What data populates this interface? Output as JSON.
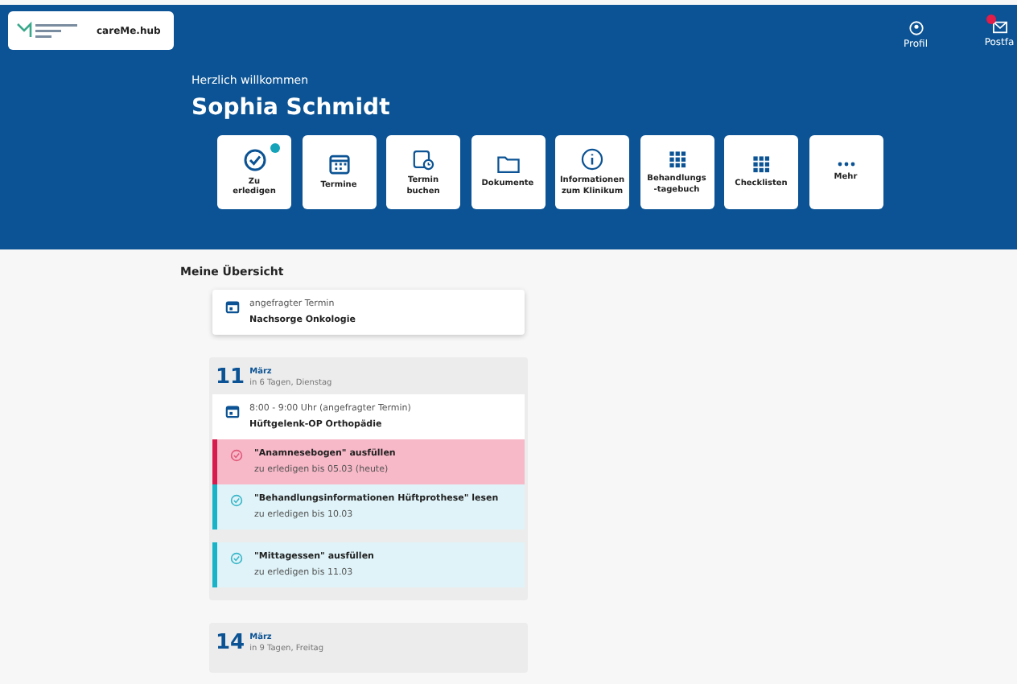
{
  "header": {
    "logo_text": "careMe.hub",
    "nav": [
      {
        "kind": "profile",
        "label": "Profil",
        "badge": false
      },
      {
        "kind": "mail",
        "label": "Postfa",
        "badge": true
      }
    ],
    "greeting": "Herzlich willkommen",
    "name": "Sophia Schmidt"
  },
  "actions": [
    {
      "kind": "check",
      "label": "Zu erledigen",
      "badge": true
    },
    {
      "kind": "calendar",
      "label": "Termine",
      "badge": false
    },
    {
      "kind": "booking",
      "label": "Termin buchen",
      "badge": false
    },
    {
      "kind": "folder",
      "label": "Dokumente",
      "badge": false
    },
    {
      "kind": "info",
      "label": "Informationen zum Klinikum",
      "badge": false
    },
    {
      "kind": "grid",
      "label": "Behandlungs -tagebuch",
      "badge": false
    },
    {
      "kind": "grid",
      "label": "Checklisten",
      "badge": false
    },
    {
      "kind": "more",
      "label": "Mehr",
      "badge": false
    }
  ],
  "overview": {
    "title": "Meine Übersicht",
    "pending": {
      "label": "angefragter Termin",
      "title": "Nachsorge Onkologie"
    },
    "days": [
      {
        "day": "11",
        "month": "März",
        "relative": "in 6 Tagen, Dienstag",
        "appointment": {
          "time": "8:00 - 9:00 Uhr (angefragter Termin)",
          "title": "Hüftgelenk-OP Orthopädie"
        },
        "tasks": [
          {
            "kind": "overdue",
            "title": "\"Anamnesebogen\" ausfüllen",
            "due": "zu erledigen bis 05.03 (heute)"
          },
          {
            "kind": "open",
            "title": "\"Behandlungsinformationen Hüftprothese\" lesen",
            "due": "zu erledigen bis 10.03"
          },
          {
            "kind": "open",
            "title": "\"Mittagessen\" ausfüllen",
            "due": "zu erledigen bis 11.03"
          }
        ]
      },
      {
        "day": "14",
        "month": "März",
        "relative": "in 9 Tagen, Freitag"
      }
    ]
  }
}
